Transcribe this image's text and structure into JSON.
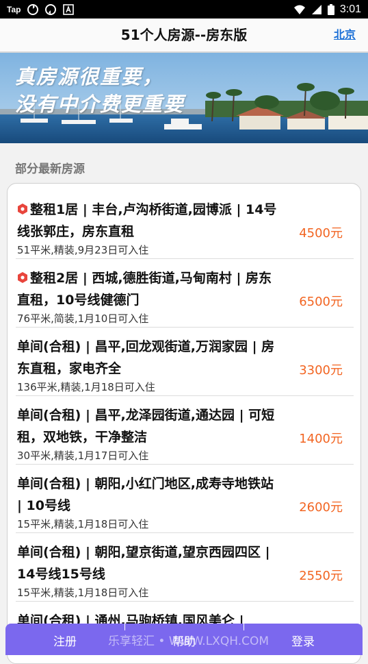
{
  "status_bar": {
    "carrier": "Tap",
    "time": "3:01",
    "icons": [
      "sync-icon",
      "sync-icon",
      "text-icon",
      "wifi-icon",
      "signal-icon",
      "battery-icon"
    ]
  },
  "header": {
    "title": "51个人房源--房东版",
    "city": "北京"
  },
  "banner": {
    "line1": "真房源很重要，",
    "line2": "没有中介费更重要"
  },
  "section_title": "部分最新房源",
  "listings": [
    {
      "title_prefix_icon": true,
      "title": "整租1居 | 丰台,卢沟桥街道,园博派 | 14号线张郭庄，房东直租",
      "sub": "51平米,精装,9月23日可入住",
      "price": "4500元"
    },
    {
      "title_prefix_icon": true,
      "title": "整租2居 | 西城,德胜街道,马甸南村 | 房东直租，10号线健德门",
      "sub": "76平米,简装,1月10日可入住",
      "price": "6500元"
    },
    {
      "title_prefix_icon": false,
      "title": "单间(合租) | 昌平,回龙观街道,万润家园 | 房东直租，家电齐全",
      "sub": "136平米,精装,1月18日可入住",
      "price": "3300元"
    },
    {
      "title_prefix_icon": false,
      "title": "单间(合租) | 昌平,龙泽园街道,通达园 | 可短租，双地铁，干净整洁",
      "sub": "30平米,精装,1月17日可入住",
      "price": "1400元"
    },
    {
      "title_prefix_icon": false,
      "title": "单间(合租) | 朝阳,小红门地区,成寿寺地铁站 | 10号线",
      "sub": "15平米,精装,1月18日可入住",
      "price": "2600元"
    },
    {
      "title_prefix_icon": false,
      "title": "单间(合租) | 朝阳,望京街道,望京西园四区 | 14号线15号线",
      "sub": "15平米,精装,1月18日可入住",
      "price": "2550元"
    },
    {
      "title_prefix_icon": false,
      "title": "单间(合租) | 通州,马驹桥镇,国风美仑 |",
      "sub": "",
      "price": ""
    }
  ],
  "tabbar": {
    "register": "注册",
    "help": "帮助",
    "login": "登录",
    "watermark": "乐享轻汇 • WWW.LXQH.COM"
  },
  "colors": {
    "accent": "#7b68ee",
    "price": "#f26522",
    "link": "#1a6fd6"
  }
}
